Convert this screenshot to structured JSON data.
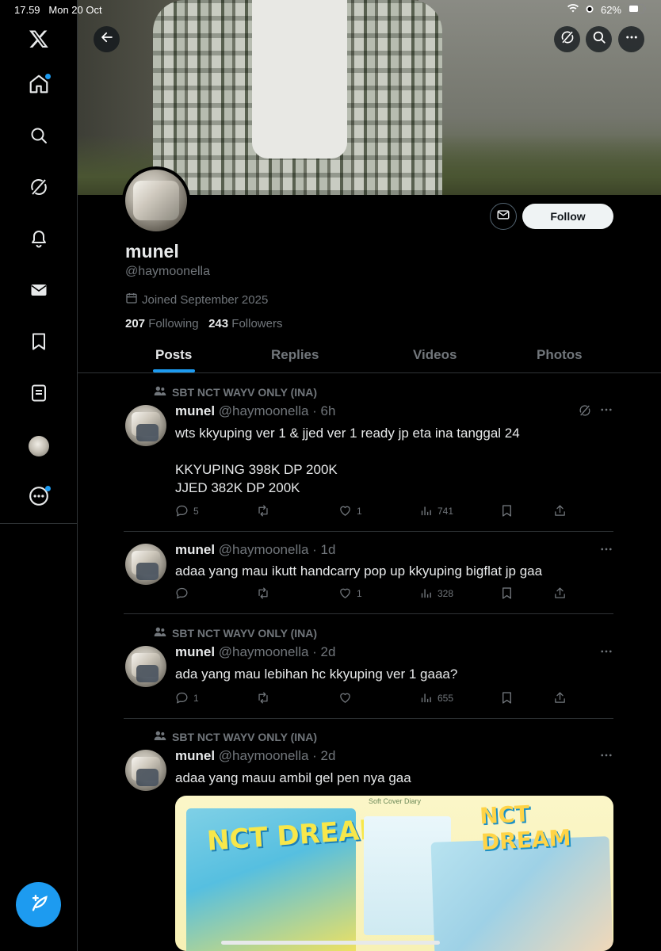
{
  "status_bar": {
    "time": "17.59",
    "date": "Mon 20 Oct",
    "battery": "62%"
  },
  "nav": {
    "items": [
      "x-logo",
      "home",
      "search",
      "grok",
      "notifications",
      "messages",
      "bookmarks",
      "lists",
      "profile",
      "more"
    ]
  },
  "profile": {
    "name": "munel",
    "handle": "@haymoonella",
    "joined": "Joined September 2025",
    "following_count": "207",
    "following_label": "Following",
    "followers_count": "243",
    "followers_label": "Followers",
    "follow_label": "Follow"
  },
  "tabs": [
    "Posts",
    "Replies",
    "Videos",
    "Photos"
  ],
  "posts": [
    {
      "community": "SBT NCT WAYV ONLY (INA)",
      "name": "munel",
      "meta": "@haymoonella · 6h",
      "text": "wts kkyuping ver 1 & jjed ver 1 ready jp eta ina tanggal 24\n\nKKYUPING 398K DP 200K\nJJED 382K DP 200K",
      "replies": "5",
      "reposts": "",
      "likes": "1",
      "views": "741"
    },
    {
      "community": "",
      "name": "munel",
      "meta": "@haymoonella · 1d",
      "text": "adaa yang mau ikutt handcarry pop up kkyuping bigflat jp gaa",
      "replies": "",
      "reposts": "",
      "likes": "1",
      "views": "328"
    },
    {
      "community": "SBT NCT WAYV ONLY (INA)",
      "name": "munel",
      "meta": "@haymoonella · 2d",
      "text": "ada yang mau lebihan hc kkyuping ver 1 gaaa?",
      "replies": "1",
      "reposts": "",
      "likes": "",
      "views": "655"
    },
    {
      "community": "SBT NCT WAYV ONLY (INA)",
      "name": "munel",
      "meta": "@haymoonella · 2d",
      "text": "adaa yang mauu ambil gel pen nya gaa",
      "replies": "",
      "reposts": "",
      "likes": "",
      "views": ""
    }
  ],
  "media": {
    "title_left": "NCT DREAM",
    "title_right": "NCT DREAM",
    "diary_label": "Soft Cover Diary"
  },
  "colors": {
    "accent": "#1d9bf0",
    "background": "#000000",
    "text": "#e7e9ea",
    "muted": "#71767b"
  }
}
